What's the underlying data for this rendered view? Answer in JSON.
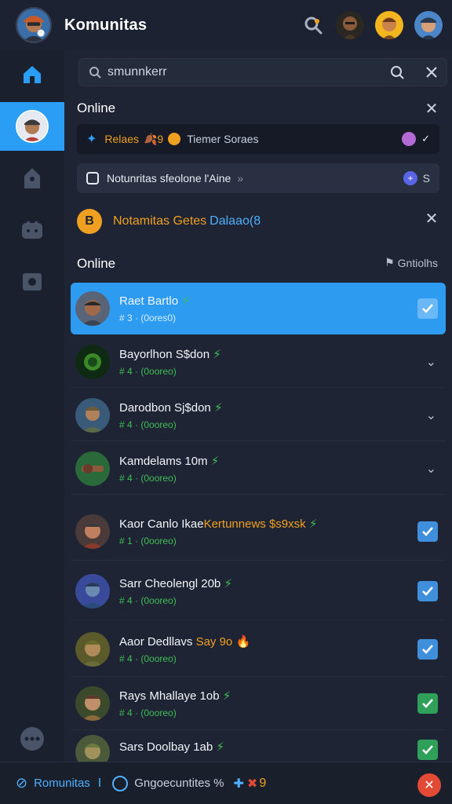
{
  "header": {
    "app_title": "Komunitas",
    "avatar_icon": "profile-avatar",
    "search_icon": "search-icon"
  },
  "search": {
    "value": "smunnkerr",
    "placeholder": ""
  },
  "sections": {
    "online_top": "Online",
    "online_list": "Online",
    "groups_label": "Gntiolhs"
  },
  "notices": [
    {
      "text": "Relaes",
      "emoji": "🍂9",
      "tail": "Tiemer Soraes"
    },
    {
      "text": "Notunritas sfeolone l'Aine",
      "arrow": "»",
      "count": "S"
    },
    {
      "text_orange": "Notamitas Getes",
      "text_blue": "Dalaao(8"
    }
  ],
  "members": [
    {
      "name": "Raet Bartlo",
      "badge": "⚡",
      "meta": "# 3 ·  (0ores0)",
      "state": "selected-check"
    },
    {
      "name": "Bayorlhon S$don",
      "badge": "⚡",
      "meta": "# 4 · (0ooreo)",
      "state": "chevron"
    },
    {
      "name": "Darodbon Sj$don",
      "badge": "⚡",
      "meta": "# 4 · (0ooreo)",
      "state": "chevron"
    },
    {
      "name": "Kamdelams 10m",
      "badge": "⚡",
      "meta": "# 4 · (0ooreo)",
      "state": "chevron"
    },
    {
      "name": "Kaor Canlo Ikae",
      "name_orange": "Kertunnews $s9xsk",
      "badge": "⚡",
      "meta": "# 1 · (0ooreo)",
      "state": "check"
    },
    {
      "name": "Sarr Cheolengl 20b",
      "badge": "⚡",
      "meta": "# 4 · (0ooreo)",
      "state": "check"
    },
    {
      "name": "Aaor Dedllavs",
      "name_orange": "Say 9o",
      "badge": "🔥",
      "meta": "# 4 · (0ooreo)",
      "state": "check"
    },
    {
      "name": "Rays Mhallaye 1ob",
      "badge": "⚡",
      "meta": "# 4 · (0ooreo)",
      "state": "green-check"
    },
    {
      "name": "Sars Doolbay 1ab",
      "badge": "⚡",
      "meta": "",
      "state": "green-check"
    }
  ],
  "footer": {
    "link1": "Romunitas",
    "separator": "I",
    "link2": "Gngoecuntites %",
    "extra": "9"
  },
  "colors": {
    "accent": "#2a9df4",
    "background": "#1e2433",
    "online_green": "#3fbf55",
    "orange": "#f0a020",
    "danger": "#e24a35"
  }
}
